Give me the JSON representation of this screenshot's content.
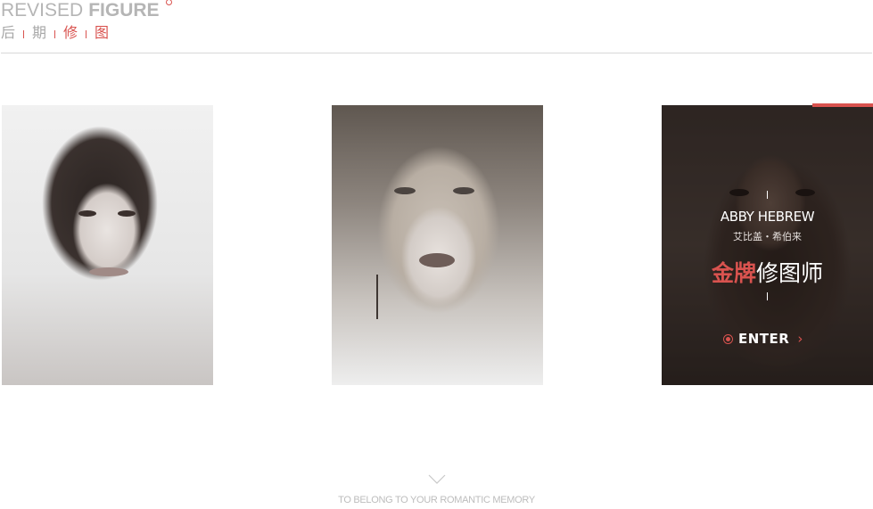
{
  "header": {
    "brand_light": "REVISED",
    "brand_bold": "FIGURE",
    "subnav": [
      "后",
      "期",
      "修",
      "图"
    ]
  },
  "cards": [
    {
      "id": "portrait-1",
      "active": false
    },
    {
      "id": "portrait-2",
      "active": false
    },
    {
      "id": "portrait-3",
      "active": true,
      "name_en": "ABBY HEBREW",
      "name_cn": "艾比盖・希伯来",
      "title_red": "金牌",
      "title_white": "修图师",
      "enter_label": "ENTER",
      "enter_arrow": "›"
    }
  ],
  "footer": {
    "scroll_icon": "chevron-down-icon",
    "tagline": "TO BELONG TO YOUR ROMANTIC MEMORY"
  },
  "colors": {
    "accent": "#d9534f",
    "brand_grey": "#b5b5b5",
    "divider": "#d8d8d8"
  }
}
